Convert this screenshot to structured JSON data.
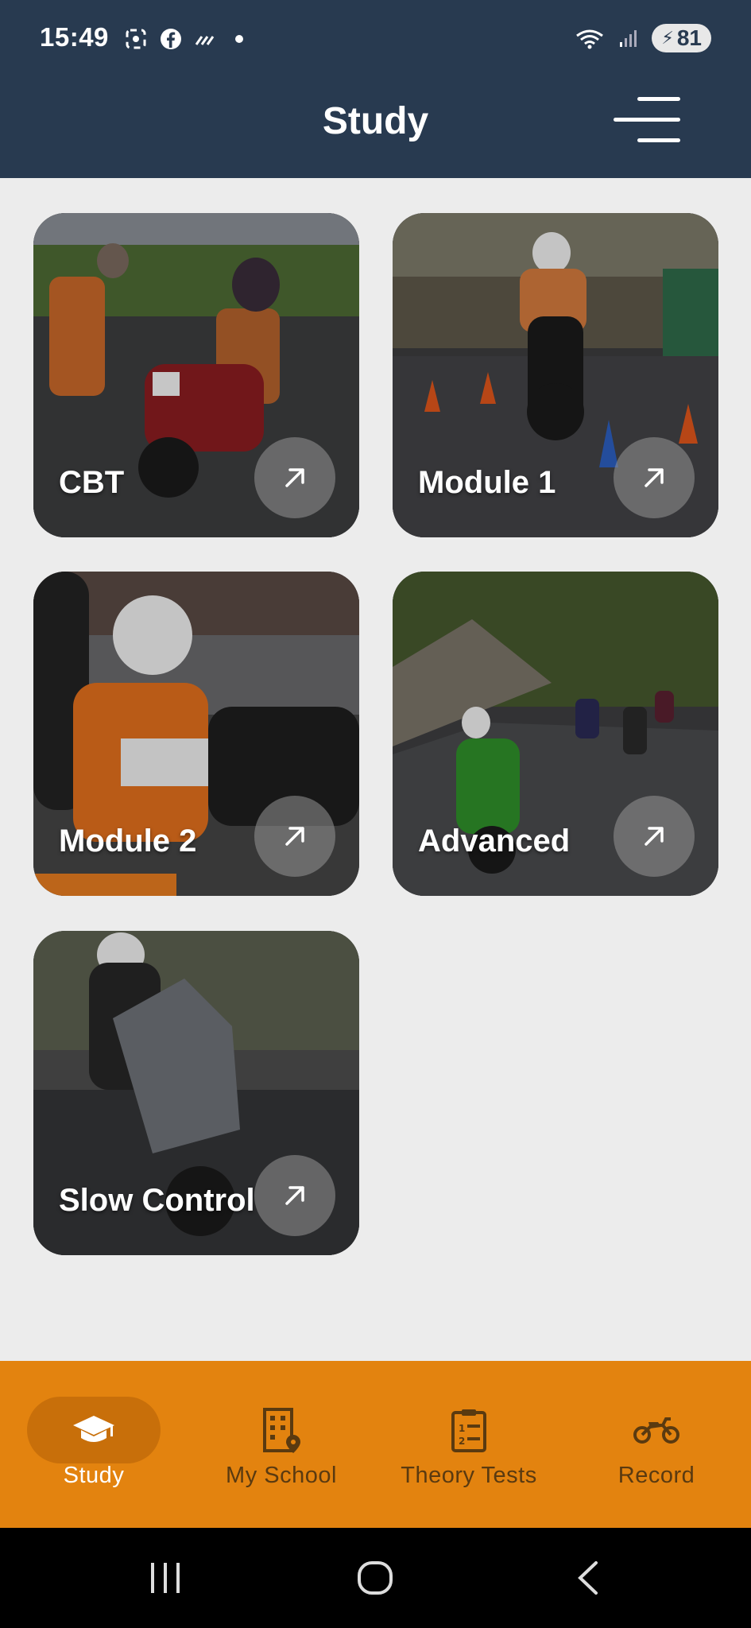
{
  "status_bar": {
    "time": "15:49",
    "battery": "81",
    "icons": [
      "screenshot-icon",
      "facebook-icon",
      "signal-strikes-icon",
      "wifi-icon",
      "cell-signal-icon",
      "battery-icon"
    ]
  },
  "header": {
    "title": "Study",
    "menu_icon": "menu-icon"
  },
  "cards": [
    {
      "label": "CBT",
      "arrow_icon": "arrow-up-right-icon"
    },
    {
      "label": "Module 1",
      "arrow_icon": "arrow-up-right-icon"
    },
    {
      "label": "Module 2",
      "arrow_icon": "arrow-up-right-icon"
    },
    {
      "label": "Advanced",
      "arrow_icon": "arrow-up-right-icon"
    },
    {
      "label": "Slow Control",
      "arrow_icon": "arrow-up-right-icon"
    }
  ],
  "bottom_nav": {
    "items": [
      {
        "label": "Study",
        "icon": "graduation-cap-icon",
        "active": true
      },
      {
        "label": "My School",
        "icon": "building-location-icon",
        "active": false
      },
      {
        "label": "Theory Tests",
        "icon": "clipboard-list-icon",
        "active": false
      },
      {
        "label": "Record",
        "icon": "motorcycle-icon",
        "active": false
      }
    ]
  },
  "colors": {
    "header_bg": "#283a50",
    "page_bg": "#ececec",
    "nav_bg": "#e3830f",
    "nav_active_pill": "#c86f0a"
  }
}
